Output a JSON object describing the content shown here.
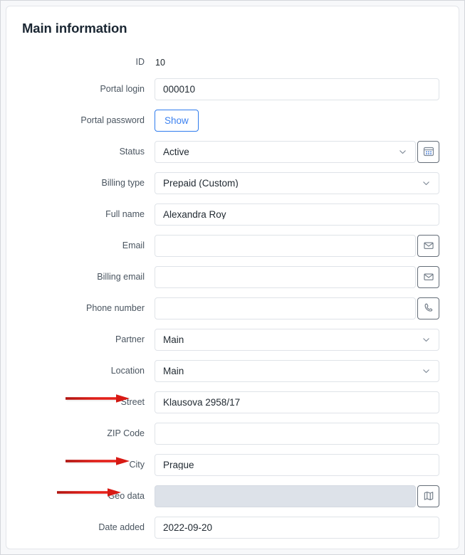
{
  "panel": {
    "title": "Main information"
  },
  "fields": {
    "id": {
      "label": "ID",
      "value": "10"
    },
    "portal_login": {
      "label": "Portal login",
      "value": "000010"
    },
    "portal_password": {
      "label": "Portal password",
      "button_label": "Show"
    },
    "status": {
      "label": "Status",
      "value": "Active",
      "action_icon": "grid-dots-icon"
    },
    "billing_type": {
      "label": "Billing type",
      "value": "Prepaid (Custom)"
    },
    "full_name": {
      "label": "Full name",
      "value": "Alexandra Roy"
    },
    "email": {
      "label": "Email",
      "value": "",
      "action_icon": "envelope-icon"
    },
    "billing_email": {
      "label": "Billing email",
      "value": "",
      "action_icon": "envelope-icon"
    },
    "phone_number": {
      "label": "Phone number",
      "value": "",
      "action_icon": "phone-icon"
    },
    "partner": {
      "label": "Partner",
      "value": "Main"
    },
    "location": {
      "label": "Location",
      "value": "Main"
    },
    "street": {
      "label": "Street",
      "value": "Klausova 2958/17"
    },
    "zip_code": {
      "label": "ZIP Code",
      "value": ""
    },
    "city": {
      "label": "City",
      "value": "Prague"
    },
    "geo_data": {
      "label": "Geo data",
      "value": "",
      "action_icon": "map-icon"
    },
    "date_added": {
      "label": "Date added",
      "value": "2022-09-20"
    }
  },
  "annotations": {
    "arrow_color": "#d61a16",
    "targets": [
      "Street",
      "City",
      "Geo data"
    ]
  },
  "colors": {
    "accent_blue": "#3d82f0",
    "text": "#222b33",
    "label": "#4a5560",
    "border": "#dfe3e8",
    "disabled_bg": "#dde2e9"
  }
}
